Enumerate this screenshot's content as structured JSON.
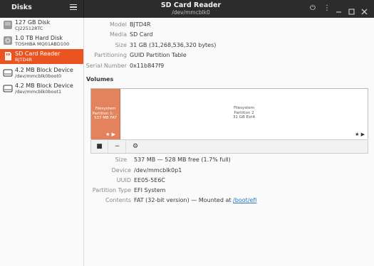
{
  "header": {
    "sidebar_title": "Disks",
    "title": "SD Card Reader",
    "subtitle": "/dev/mmcblk0",
    "power_glyph": "⏻",
    "more_glyph": "⋮",
    "minimize_glyph": "–",
    "maximize_glyph": "□",
    "close_glyph": "✕"
  },
  "sidebar": {
    "items": [
      {
        "name": "127 GB Disk",
        "sub": "CJ225128TC",
        "icon": "disk-icon"
      },
      {
        "name": "1.0 TB Hard Disk",
        "sub": "TOSHIBA MQ01ABD100",
        "icon": "hard-disk-icon"
      },
      {
        "name": "SD Card Reader",
        "sub": "BJTD4R",
        "icon": "sd-card-icon",
        "selected": true
      },
      {
        "name": "4.2 MB Block Device",
        "sub": "/dev/mmcblk0boot0",
        "icon": "block-device-icon"
      },
      {
        "name": "4.2 MB Block Device",
        "sub": "/dev/mmcblk0boot1",
        "icon": "block-device-icon"
      }
    ]
  },
  "drive": {
    "model_label": "Model",
    "model": "BJTD4R",
    "media_label": "Media",
    "media": "SD Card",
    "size_label": "Size",
    "size": "31 GB (31,268,536,320 bytes)",
    "partitioning_label": "Partitioning",
    "partitioning": "GUID Partition Table",
    "serial_label": "Serial Number",
    "serial": "0x11b847f9"
  },
  "volumes": {
    "title": "Volumes",
    "partitions": [
      {
        "line1": "Filesystem",
        "line2": "Partition 1: ...",
        "line3": "537 MB FAT",
        "selected": true
      },
      {
        "line1": "Filesystem",
        "line2": "Partition 2",
        "line3": "31 GB Ext4"
      }
    ],
    "mark": "★ ▶",
    "toolbar": {
      "stop": "■",
      "remove": "−",
      "settings": "⚙"
    }
  },
  "partition": {
    "size_label": "Size",
    "size": "537 MB — 528 MB free (1.7% full)",
    "device_label": "Device",
    "device": "/dev/mmcblk0p1",
    "uuid_label": "UUID",
    "uuid": "EE05-5E6C",
    "type_label": "Partition Type",
    "type": "EFI System",
    "contents_label": "Contents",
    "contents_prefix": "FAT (32-bit version) — Mounted at ",
    "mount_point": "/boot/efi"
  },
  "colors": {
    "accent": "#e95420",
    "header_bg": "#2c2c2c",
    "partition_fill": "#e3835d",
    "link": "#2a76c6"
  }
}
